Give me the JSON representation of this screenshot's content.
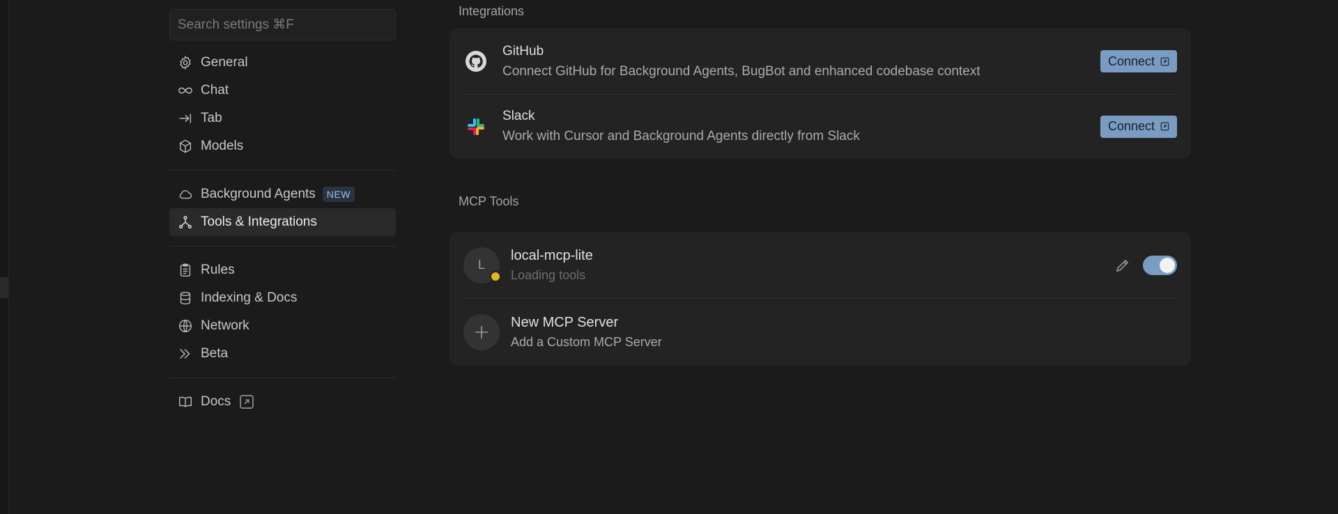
{
  "search": {
    "placeholder": "Search settings ⌘F"
  },
  "sidebar": {
    "groups": [
      {
        "items": [
          {
            "label": "General",
            "icon": "gear-icon"
          },
          {
            "label": "Chat",
            "icon": "infinity-icon"
          },
          {
            "label": "Tab",
            "icon": "arrow-right-bar-icon"
          },
          {
            "label": "Models",
            "icon": "cube-icon"
          }
        ]
      },
      {
        "items": [
          {
            "label": "Background Agents",
            "icon": "cloud-icon",
            "badge": "NEW"
          },
          {
            "label": "Tools & Integrations",
            "icon": "network-icon",
            "active": true
          }
        ]
      },
      {
        "items": [
          {
            "label": "Rules",
            "icon": "clipboard-icon"
          },
          {
            "label": "Indexing & Docs",
            "icon": "database-icon"
          },
          {
            "label": "Network",
            "icon": "globe-icon"
          },
          {
            "label": "Beta",
            "icon": "double-chevron-icon"
          }
        ]
      },
      {
        "items": [
          {
            "label": "Docs",
            "icon": "book-icon",
            "external": true
          }
        ]
      }
    ]
  },
  "integrations": {
    "title": "Integrations",
    "items": [
      {
        "name": "GitHub",
        "icon": "github-icon",
        "description": "Connect GitHub for Background Agents, BugBot and enhanced codebase context",
        "button": "Connect"
      },
      {
        "name": "Slack",
        "icon": "slack-icon",
        "description": "Work with Cursor and Background Agents directly from Slack",
        "button": "Connect"
      }
    ]
  },
  "mcp": {
    "title": "MCP Tools",
    "servers": [
      {
        "name": "local-mcp-lite",
        "avatar": "L",
        "status": "Loading tools",
        "enabled": true,
        "status_color": "#e6b422"
      }
    ],
    "new_server": {
      "title": "New MCP Server",
      "subtitle": "Add a Custom MCP Server"
    }
  },
  "colors": {
    "accent": "#7a9cc2",
    "background": "#1b1b1b",
    "card": "#232323"
  }
}
